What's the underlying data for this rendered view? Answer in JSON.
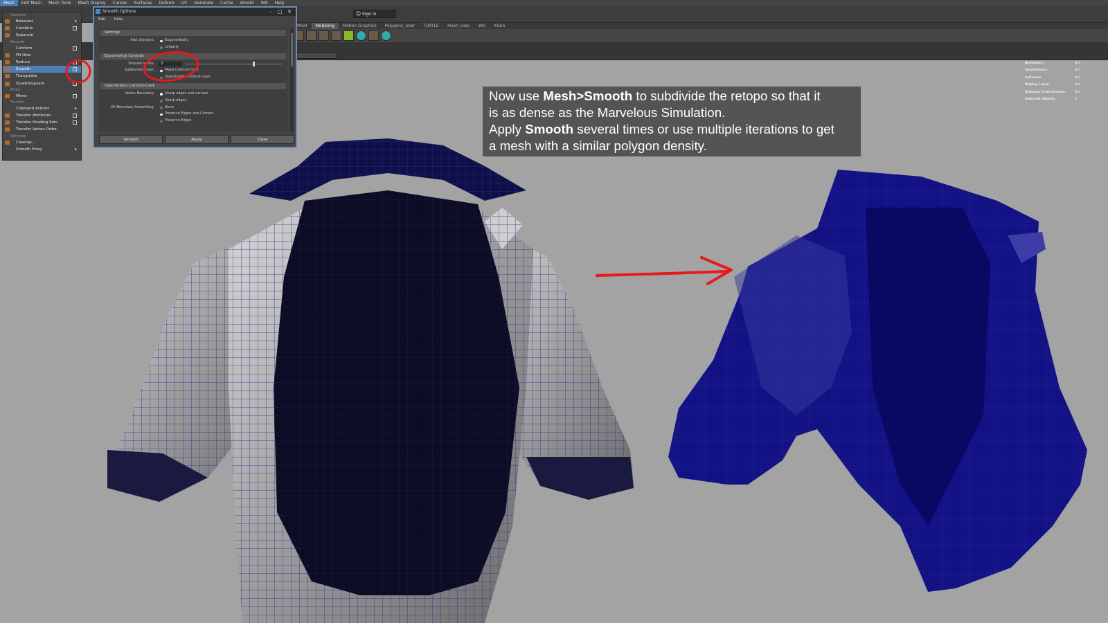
{
  "menubar": [
    "Mesh",
    "Edit Mesh",
    "Mesh Tools",
    "Mesh Display",
    "Curves",
    "Surfaces",
    "Deform",
    "UV",
    "Generate",
    "Cache",
    "Arnold",
    "Yeti",
    "Help"
  ],
  "topbar": {
    "signin": "Sign in"
  },
  "shelf_tabs": [
    "MASH",
    "Modeling",
    "Motion Graphics",
    "Polygons_User",
    "TURTLE",
    "XGen_User",
    "Yeti",
    "XGen"
  ],
  "mesh_menu": {
    "combine_header": "Combine",
    "booleans": "Booleans",
    "combine": "Combine",
    "separate": "Separate",
    "remesh_header": "Remesh",
    "conform": "Conform",
    "fill_hole": "Fill Hole",
    "reduce": "Reduce",
    "smooth": "Smooth",
    "triangulate": "Triangulate",
    "quadrangulate": "Quadrangulate",
    "mirror_header": "Mirror",
    "mirror": "Mirror",
    "transfer_header": "Transfer",
    "clipboard_actions": "Clipboard Actions",
    "transfer_attributes": "Transfer Attributes",
    "transfer_shading_sets": "Transfer Shading Sets",
    "transfer_vertex_order": "Transfer Vertex Order",
    "optimize_header": "Optimize",
    "cleanup": "Cleanup...",
    "smooth_proxy": "Smooth Proxy"
  },
  "dialog": {
    "title": "Smooth Options",
    "menu_edit": "Edit",
    "menu_help": "Help",
    "settings_header": "Settings",
    "add_divisions_label": "Add divisions:",
    "add_divisions_opt1": "Exponentially",
    "add_divisions_opt2": "Linearly",
    "exp_controls_header": "Exponential Controls",
    "division_levels_label": "Division levels:",
    "division_levels_value": "3",
    "division_levels_fraction": 0.7,
    "subdivision_type_label": "Subdivision type:",
    "subdivision_opt1": "Maya Catmull-Clark",
    "subdivision_opt2": "OpenSubdiv Catmull-Clark",
    "opensubdiv_header": "OpenSubdiv Catmull-Clark",
    "vertex_boundary_label": "Vertex Boundary:",
    "vertex_boundary_opt1": "Sharp edges and corners",
    "vertex_boundary_opt2": "Sharp edges",
    "uv_boundary_label": "UV Boundary Smoothing:",
    "uv_opt1": "None",
    "uv_opt2": "Preserve Edges and Corners",
    "uv_opt3": "Preserve Edges",
    "btn_smooth": "Smooth",
    "btn_apply": "Apply",
    "btn_close": "Close"
  },
  "hud": [
    {
      "label": "Backfaces:",
      "value": "N/A"
    },
    {
      "label": "Smoothness:",
      "value": "N/A"
    },
    {
      "label": "Instance:",
      "value": "N/A"
    },
    {
      "label": "Display Layer:",
      "value": "N/A"
    },
    {
      "label": "Distance From Camera:",
      "value": "N/A"
    },
    {
      "label": "Selected Objects:",
      "value": "0"
    }
  ],
  "callout": {
    "l1_a": "Now use ",
    "l1_b": "Mesh>Smooth",
    "l1_c": " to subdivide the retopo so that it",
    "l2": "is as dense as the Marvelous Simulation.",
    "l3_a": "Apply ",
    "l3_b": "Smooth",
    "l3_c": " several times or use multiple iterations to get",
    "l4": "a mesh with a similar polygon density."
  },
  "colors": {
    "viewport_bg": "#a3a3a3",
    "wire": "#1e1e8c",
    "dense_mesh": "#10107a",
    "annotation": "#e8191a",
    "highlight": "#4f7db3"
  }
}
